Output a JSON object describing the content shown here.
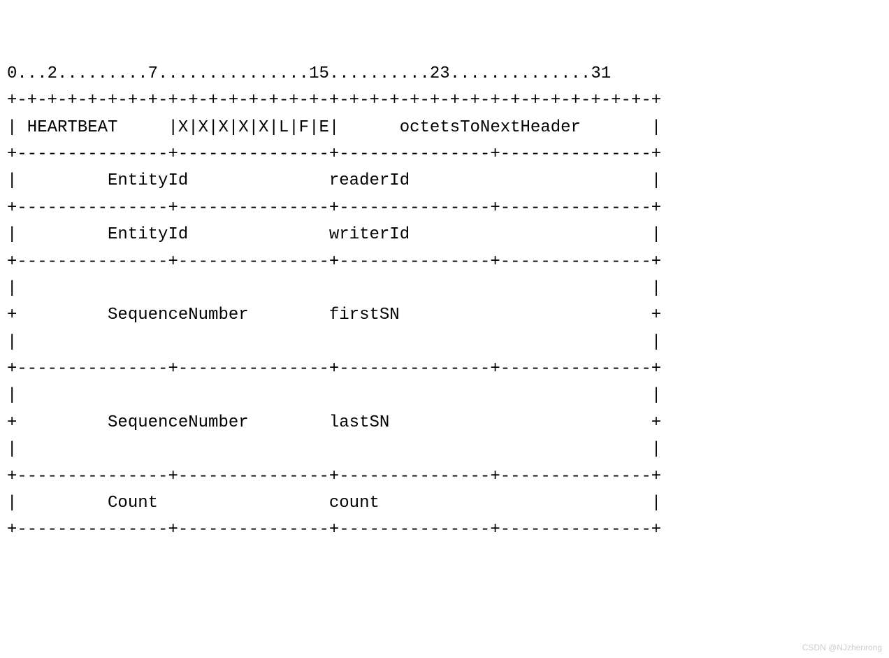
{
  "diagram": {
    "type": "packet_structure",
    "name": "HEARTBEAT",
    "bit_ruler": {
      "markers": [
        0,
        2,
        7,
        15,
        23,
        31
      ],
      "text": "0...2.........7...............15..........23..............31"
    },
    "rows": [
      {
        "separator": "+-+-+-+-+-+-+-+-+-+-+-+-+-+-+-+-+-+-+-+-+-+-+-+-+-+-+-+-+-+-+-+-+",
        "fields": [
          {
            "label": "HEARTBEAT",
            "bits": "0-7"
          },
          {
            "label": "X|X|X|X|X|L|F|E",
            "bits": "8-15",
            "flags": [
              "X",
              "X",
              "X",
              "X",
              "X",
              "L",
              "F",
              "E"
            ]
          },
          {
            "label": "octetsToNextHeader",
            "bits": "16-31"
          }
        ],
        "text": "| HEARTBEAT     |X|X|X|X|X|L|F|E|      octetsToNextHeader       |"
      },
      {
        "separator": "+---------------+---------------+---------------+---------------+",
        "fields": [
          {
            "type_label": "EntityId",
            "name_label": "readerId",
            "bits": "0-31"
          }
        ],
        "text": "|         EntityId              readerId                        |"
      },
      {
        "separator": "+---------------+---------------+---------------+---------------+",
        "fields": [
          {
            "type_label": "EntityId",
            "name_label": "writerId",
            "bits": "0-31"
          }
        ],
        "text": "|         EntityId              writerId                        |"
      },
      {
        "separator": "+---------------+---------------+---------------+---------------+",
        "fields": [
          {
            "type_label": "SequenceNumber",
            "name_label": "firstSN",
            "bits": "0-31",
            "multiline": true
          }
        ],
        "text_lines": [
          "|                                                               |",
          "+         SequenceNumber        firstSN                         +",
          "|                                                               |"
        ]
      },
      {
        "separator": "+---------------+---------------+---------------+---------------+",
        "fields": [
          {
            "type_label": "SequenceNumber",
            "name_label": "lastSN",
            "bits": "0-31",
            "multiline": true
          }
        ],
        "text_lines": [
          "|                                                               |",
          "+         SequenceNumber        lastSN                          +",
          "|                                                               |"
        ]
      },
      {
        "separator": "+---------------+---------------+---------------+---------------+",
        "fields": [
          {
            "type_label": "Count",
            "name_label": "count",
            "bits": "0-31"
          }
        ],
        "text": "|         Count                 count                           |"
      }
    ],
    "final_separator": "+---------------+---------------+---------------+---------------+"
  },
  "lines": {
    "l0": "0...2.........7...............15..........23..............31",
    "l1": "+-+-+-+-+-+-+-+-+-+-+-+-+-+-+-+-+-+-+-+-+-+-+-+-+-+-+-+-+-+-+-+-+",
    "l2": "| HEARTBEAT     |X|X|X|X|X|L|F|E|      octetsToNextHeader       |",
    "l3": "+---------------+---------------+---------------+---------------+",
    "l4": "|         EntityId              readerId                        |",
    "l5": "+---------------+---------------+---------------+---------------+",
    "l6": "|         EntityId              writerId                        |",
    "l7": "+---------------+---------------+---------------+---------------+",
    "l8": "|                                                               |",
    "l9": "+         SequenceNumber        firstSN                         +",
    "l10": "|                                                               |",
    "l11": "+---------------+---------------+---------------+---------------+",
    "l12": "|                                                               |",
    "l13": "+         SequenceNumber        lastSN                          +",
    "l14": "|                                                               |",
    "l15": "+---------------+---------------+---------------+---------------+",
    "l16": "|         Count                 count                           |",
    "l17": "+---------------+---------------+---------------+---------------+"
  },
  "watermark": "CSDN @NJzhenrong"
}
